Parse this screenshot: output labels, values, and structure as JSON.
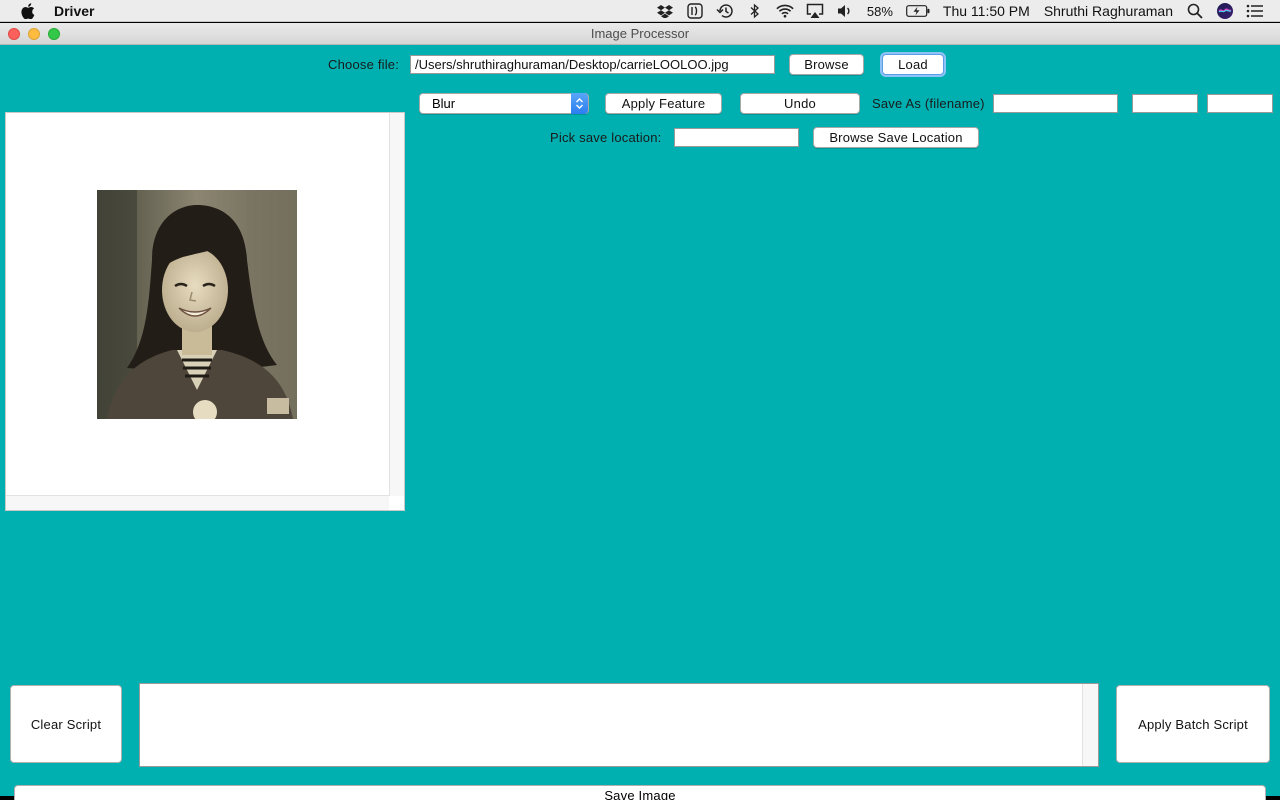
{
  "menubar": {
    "app_name": "Driver",
    "battery": "58%",
    "clock": "Thu 11:50 PM",
    "user": "Shruthi Raghuraman",
    "tray_icons": [
      "dropbox-icon",
      "stack-icon",
      "time-machine-icon",
      "bluetooth-icon",
      "wifi-icon",
      "airplay-icon",
      "volume-icon",
      "battery-icon",
      "spotlight-icon",
      "siri-icon",
      "notification-center-icon"
    ]
  },
  "window": {
    "title": "Image Processor"
  },
  "file": {
    "choose_label": "Choose file:",
    "path": "/Users/shruthiraghuraman/Desktop/carrieLOOLOO.jpg",
    "browse_label": "Browse",
    "load_label": "Load"
  },
  "toolbar": {
    "feature_selected": "Blur",
    "apply_label": "Apply Feature",
    "undo_label": "Undo",
    "save_as_label": "Save As (filename)",
    "filename_value": "",
    "extra_field_1": "",
    "extra_field_2": ""
  },
  "save_location": {
    "label": "Pick save location:",
    "value": "",
    "browse_label": "Browse Save Location"
  },
  "script": {
    "clear_label": "Clear Script",
    "text": "",
    "apply_label": "Apply Batch Script"
  },
  "footer": {
    "save_label": "Save Image"
  },
  "colors": {
    "window_background": "#00b0b1",
    "select_accent": "#2a7ef0"
  }
}
